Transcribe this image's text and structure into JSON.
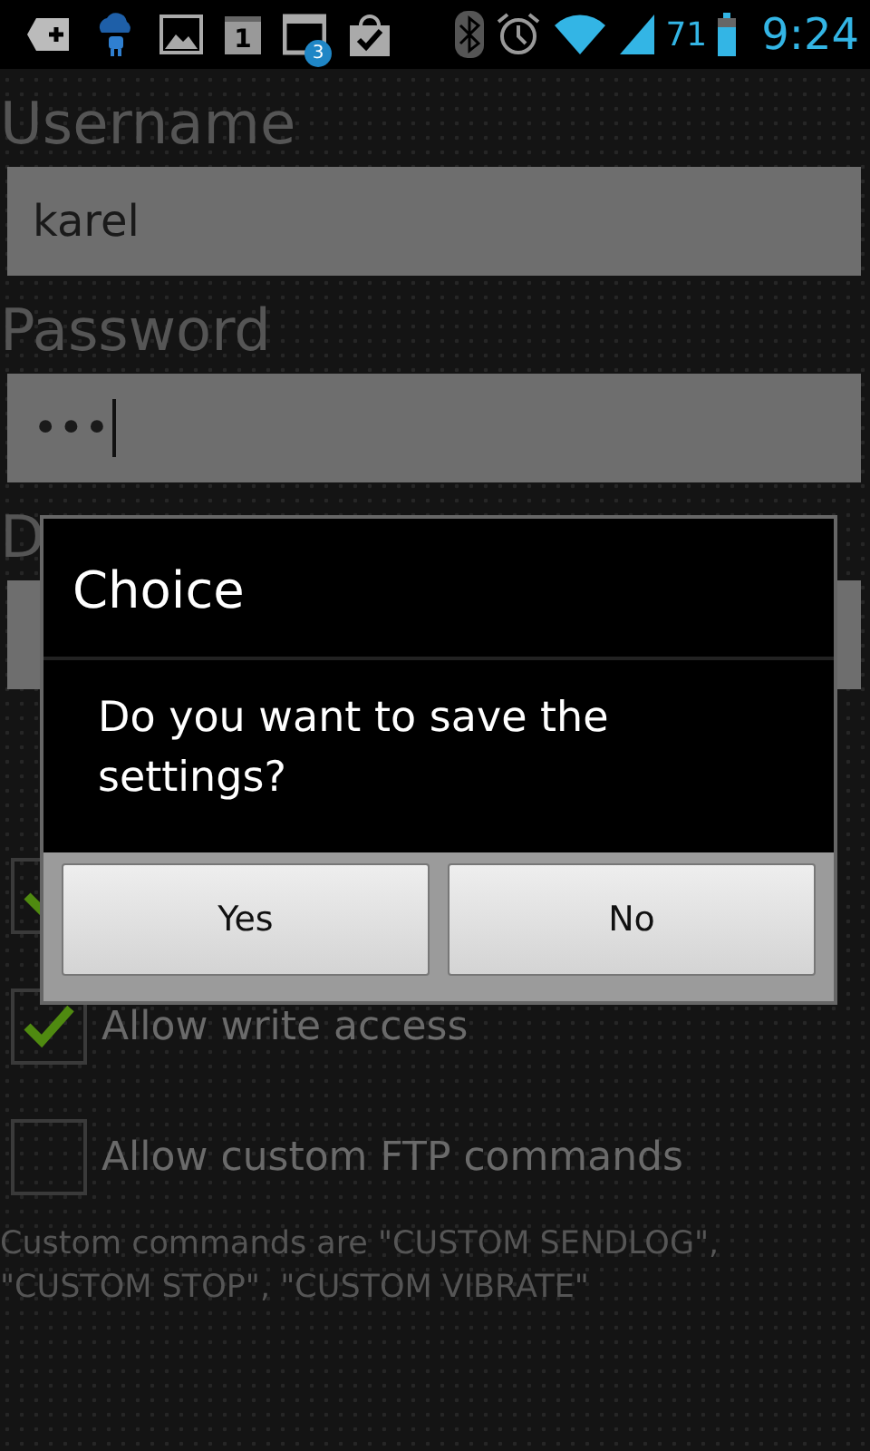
{
  "status_bar": {
    "battery": "71",
    "time": "9:24",
    "notification_badge": "3",
    "calendar_day": "1"
  },
  "form": {
    "username": {
      "label": "Username",
      "value": "karel"
    },
    "password": {
      "label": "Password",
      "value": "•••"
    },
    "document_root": {
      "label": "D"
    },
    "checkboxes": [
      {
        "checked": true
      },
      {
        "label": "Allow write access",
        "checked": true
      },
      {
        "label": "Allow custom FTP commands",
        "checked": false
      }
    ],
    "hint": "Custom commands are \"CUSTOM SENDLOG\", \"CUSTOM STOP\", \"CUSTOM VIBRATE\""
  },
  "dialog": {
    "title": "Choice",
    "message": "Do you want to save the settings?",
    "buttons": [
      "Yes",
      "No"
    ]
  }
}
